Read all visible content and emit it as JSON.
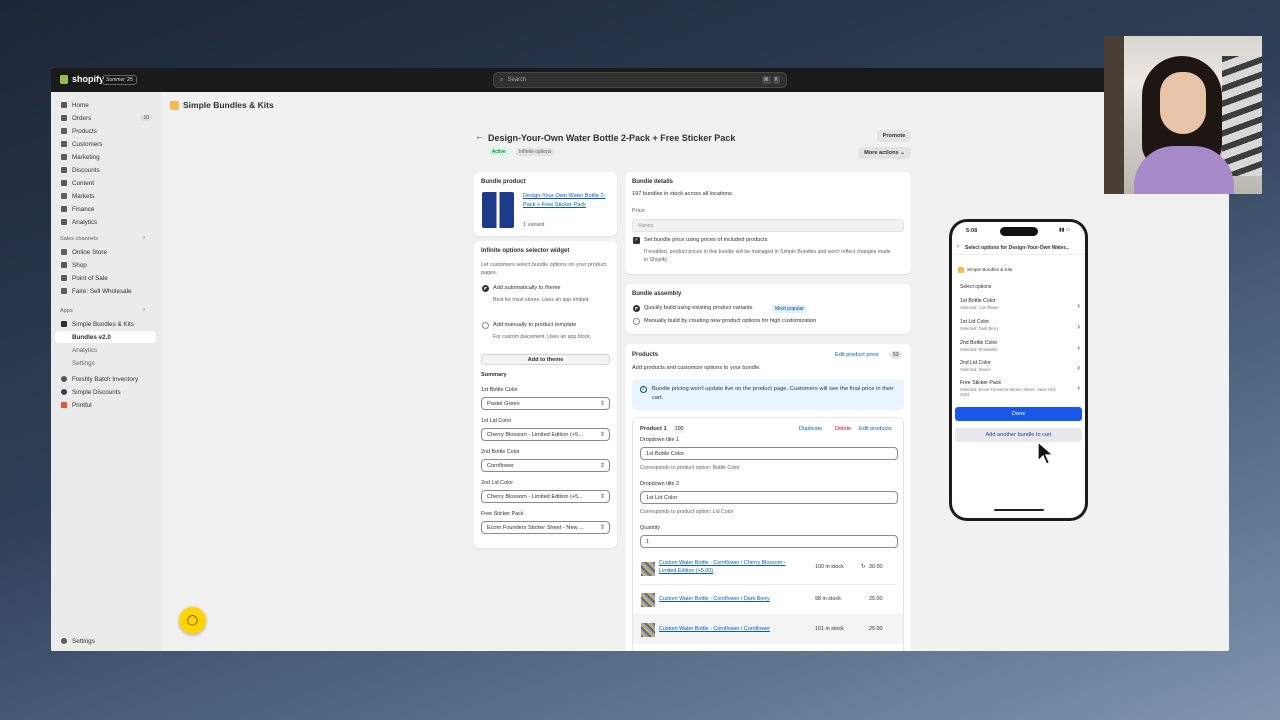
{
  "topbar": {
    "brand": "shopify",
    "edition": "Summer '25",
    "search_placeholder": "Search",
    "shortcut_keys": [
      "⌘",
      "K"
    ]
  },
  "sidebar": {
    "items": [
      {
        "label": "Home",
        "icon": "home-icon"
      },
      {
        "label": "Orders",
        "icon": "orders-icon",
        "badge": "10"
      },
      {
        "label": "Products",
        "icon": "tag-icon"
      },
      {
        "label": "Customers",
        "icon": "person-icon"
      },
      {
        "label": "Marketing",
        "icon": "target-icon"
      },
      {
        "label": "Discounts",
        "icon": "discount-icon"
      },
      {
        "label": "Content",
        "icon": "content-icon"
      },
      {
        "label": "Markets",
        "icon": "globe-icon"
      },
      {
        "label": "Finance",
        "icon": "bank-icon"
      },
      {
        "label": "Analytics",
        "icon": "chart-icon"
      }
    ],
    "sales_channels_heading": "Sales channels",
    "channels": [
      "Online Store",
      "Shop",
      "Point of Sale",
      "Faire: Sell Wholesale"
    ],
    "apps_heading": "Apps",
    "apps": [
      "Simple Bundles & Kits",
      "Bundles v2.0",
      "Analytics",
      "Settings",
      "Freshly Batch Inventory",
      "Simple Discounts",
      "Printful"
    ],
    "settings": "Settings"
  },
  "app_header": {
    "title": "Simple Bundles & Kits"
  },
  "page": {
    "title": "Design-Your-Own Water Bottle 2-Pack + Free Sticker Pack",
    "status": "Active",
    "tag": "Infinite options",
    "promote": "Promote",
    "more_actions": "More actions"
  },
  "bundle_product": {
    "heading": "Bundle product",
    "name": "Design-Your-Own Water Bottle 2-Pack + Free Sticker Pack",
    "variants": "1 variant"
  },
  "widget": {
    "heading": "Infinite options selector widget",
    "description": "Let customers select bundle options on your product pages.",
    "option1_label": "Add automatically to theme",
    "option1_desc": "Best for most stores. Uses an app embed.",
    "option2_label": "Add manually to product template",
    "option2_desc": "For custom placement. Uses an app block.",
    "add_button": "Add to theme",
    "summary_heading": "Summary",
    "fields": [
      {
        "label": "1st Bottle Color",
        "value": "Pastel Green"
      },
      {
        "label": "1st Lid Color",
        "value": "Cherry Blossom - Limited Edition (+5..."
      },
      {
        "label": "2nd Bottle Color",
        "value": "Cornflower"
      },
      {
        "label": "2nd Lid Color",
        "value": "Cherry Blossom - Limited Edition (+5..."
      },
      {
        "label": "Free Sticker Pack",
        "value": "Ecom Founders Sticker Sheet - New ..."
      }
    ]
  },
  "bundle_details": {
    "heading": "Bundle details",
    "stock": "197 bundles in stock across all locations.",
    "price_label": "Price",
    "price_value": "Varies",
    "checkbox_label": "Set bundle price using prices of included products",
    "checkbox_help": "If enabled, product prices in this bundle will be managed in Simple Bundles and won't reflect changes made in Shopify."
  },
  "assembly": {
    "heading": "Bundle assembly",
    "option1": "Quickly build using existing product variants",
    "badge": "Most popular",
    "option2": "Manually build by creating new product options for high customization"
  },
  "products": {
    "heading": "Products",
    "edit_price": "Edit product price",
    "price_count": "53",
    "subtitle": "Add products and customize options to your bundle.",
    "notice": "Bundle pricing won't update live on the product page. Customers will see the final price in their cart.",
    "product_label": "Product 1",
    "product_count": "100",
    "duplicate": "Duplicate",
    "delete": "Delete",
    "edit_products": "Edit products",
    "dropdown1_label": "Dropdown title 1",
    "dropdown1_value": "1st Bottle Color",
    "dropdown1_help": "Corresponds to product option: Bottle Color",
    "dropdown2_label": "Dropdown title 2",
    "dropdown2_value": "1st Lid Color",
    "dropdown2_help": "Corresponds to product option: Lid Color",
    "quantity_label": "Quantity",
    "quantity_value": "1",
    "rows": [
      {
        "name": "Custom Water Bottle - Cornflower / Cherry Blossom - Limited Edition (+5.00)",
        "stock": "100 in stock",
        "price": "30.00"
      },
      {
        "name": "Custom Water Bottle - Cornflower / Dark Berry",
        "stock": "98 in stock",
        "price": "25.00"
      },
      {
        "name": "Custom Water Bottle - Cornflower / Cornflower",
        "stock": "101 in stock",
        "price": "25.00"
      }
    ]
  },
  "phone": {
    "time": "5:08",
    "header": "Select options for Design-Your-Own Water...",
    "shop": "Simple Bundles & Kits",
    "select_label": "Select options",
    "options": [
      {
        "name": "1st Bottle Color",
        "selected": "Selected: Cornflower"
      },
      {
        "name": "1st Lid Color",
        "selected": "Selected: Dark Berry"
      },
      {
        "name": "2nd Bottle Color",
        "selected": "Selected: Periwinkle"
      },
      {
        "name": "2nd Lid Color",
        "selected": "Selected: Denim"
      },
      {
        "name": "Free Sticker Pack",
        "selected": "Selected: Ecom Founders Sticker Sheet - New York 2024"
      }
    ],
    "done": "Done",
    "add_another": "Add another bundle to cart"
  }
}
